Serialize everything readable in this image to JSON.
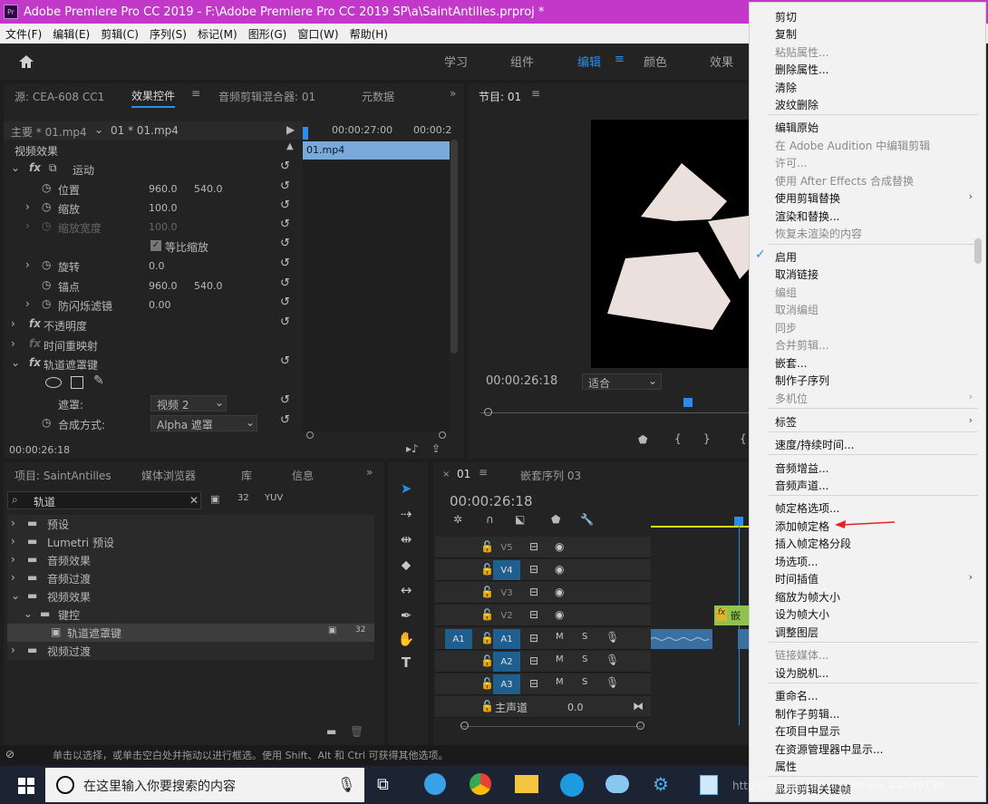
{
  "titlebar": {
    "app_icon": "Pr",
    "title": "Adobe Premiere Pro CC 2019 - F:\\Adobe Premiere Pro CC 2019 SP\\a\\SaintAntilles.prproj *"
  },
  "menubar": [
    "文件(F)",
    "编辑(E)",
    "剪辑(C)",
    "序列(S)",
    "标记(M)",
    "图形(G)",
    "窗口(W)",
    "帮助(H)"
  ],
  "workspaces": {
    "items": [
      "学习",
      "组件",
      "编辑",
      "颜色",
      "效果"
    ],
    "active": "编辑"
  },
  "effects_panel": {
    "tabs": [
      "源: CEA-608 CC1",
      "效果控件",
      "音频剪辑混合器: 01",
      "元数据"
    ],
    "active_tab": "效果控件",
    "clip_master": "主要 * 01.mp4",
    "clip_current": "01 * 01.mp4",
    "time_a": "00:00:27:00",
    "time_b": "00:00:2",
    "clip_bar": "01.mp4",
    "section": "视频效果",
    "motion": "运动",
    "position_label": "位置",
    "position_x": "960.0",
    "position_y": "540.0",
    "scale_label": "缩放",
    "scale_value": "100.0",
    "scale_width_label": "缩放宽度",
    "scale_width_value": "100.0",
    "uniform_scale_label": "等比缩放",
    "rotation_label": "旋转",
    "rotation_value": "0.0",
    "anchor_label": "锚点",
    "anchor_x": "960.0",
    "anchor_y": "540.0",
    "flicker_label": "防闪烁滤镜",
    "flicker_value": "0.00",
    "opacity_label": "不透明度",
    "time_remap_label": "时间重映射",
    "track_matte_label": "轨道遮罩键",
    "matte_label": "遮罩:",
    "matte_value": "视频 2",
    "composite_label": "合成方式:",
    "composite_value": "Alpha 遮罩",
    "timecode": "00:00:26:18"
  },
  "program_monitor": {
    "title": "节目: 01",
    "timecode": "00:00:26:18",
    "fit": "适合"
  },
  "project_panel": {
    "tabs": [
      "项目: SaintAntilles",
      "媒体浏览器",
      "库",
      "信息"
    ],
    "search": "轨道",
    "rows": [
      {
        "label": "预设",
        "indent": 0
      },
      {
        "label": "Lumetri 预设",
        "indent": 0
      },
      {
        "label": "音频效果",
        "indent": 0
      },
      {
        "label": "音频过渡",
        "indent": 0
      },
      {
        "label": "视频效果",
        "indent": 0
      },
      {
        "label": "键控",
        "indent": 1
      },
      {
        "label": "轨道遮罩键",
        "indent": 2
      },
      {
        "label": "视频过渡",
        "indent": 0
      }
    ]
  },
  "timeline": {
    "tab_active": "01",
    "tab_nested": "嵌套序列 03",
    "timecode": "00:00:26:18",
    "video_tracks": [
      "V5",
      "V4",
      "V3",
      "V2"
    ],
    "audio_tracks": [
      "A1",
      "A2",
      "A3"
    ],
    "source_patch": "A1",
    "master_label": "主声道",
    "master_value": "0.0",
    "mute": "M",
    "solo": "S",
    "fx": "fx",
    "clip_v2_label": "嵌"
  },
  "status_bar": "单击以选择，或单击空白处并拖动以进行框选。使用 Shift、Alt 和 Ctrl 可获得其他选项。",
  "context_menu": {
    "items": [
      {
        "label": "剪切",
        "enabled": true
      },
      {
        "label": "复制",
        "enabled": true
      },
      {
        "label": "粘贴属性...",
        "enabled": false
      },
      {
        "label": "删除属性...",
        "enabled": true
      },
      {
        "label": "清除",
        "enabled": true
      },
      {
        "label": "波纹删除",
        "enabled": true
      },
      {
        "label": "编辑原始",
        "enabled": true
      },
      {
        "label": "在 Adobe Audition 中编辑剪辑",
        "enabled": false
      },
      {
        "label": "许可...",
        "enabled": false
      },
      {
        "label": "使用 After Effects 合成替换",
        "enabled": false
      },
      {
        "label": "使用剪辑替换",
        "enabled": true
      },
      {
        "label": "渲染和替换...",
        "enabled": true
      },
      {
        "label": "恢复未渲染的内容",
        "enabled": false
      },
      {
        "label": "启用",
        "enabled": true
      },
      {
        "label": "取消链接",
        "enabled": true
      },
      {
        "label": "编组",
        "enabled": false
      },
      {
        "label": "取消编组",
        "enabled": false
      },
      {
        "label": "同步",
        "enabled": false
      },
      {
        "label": "合并剪辑...",
        "enabled": false
      },
      {
        "label": "嵌套...",
        "enabled": true
      },
      {
        "label": "制作子序列",
        "enabled": true
      },
      {
        "label": "多机位",
        "enabled": false
      },
      {
        "label": "标签",
        "enabled": true
      },
      {
        "label": "速度/持续时间...",
        "enabled": true
      },
      {
        "label": "音频增益...",
        "enabled": true
      },
      {
        "label": "音频声道...",
        "enabled": true
      },
      {
        "label": "帧定格选项...",
        "enabled": true
      },
      {
        "label": "添加帧定格",
        "enabled": true
      },
      {
        "label": "插入帧定格分段",
        "enabled": true
      },
      {
        "label": "场选项...",
        "enabled": true
      },
      {
        "label": "时间插值",
        "enabled": true
      },
      {
        "label": "缩放为帧大小",
        "enabled": true
      },
      {
        "label": "设为帧大小",
        "enabled": true
      },
      {
        "label": "调整图层",
        "enabled": true
      },
      {
        "label": "链接媒体...",
        "enabled": false
      },
      {
        "label": "设为脱机...",
        "enabled": true
      },
      {
        "label": "重命名...",
        "enabled": true
      },
      {
        "label": "制作子剪辑...",
        "enabled": true
      },
      {
        "label": "在项目中显示",
        "enabled": true
      },
      {
        "label": "在资源管理器中显示...",
        "enabled": true
      },
      {
        "label": "属性",
        "enabled": true
      },
      {
        "label": "显示剪辑关键帧",
        "enabled": true
      }
    ]
  },
  "taskbar": {
    "search_placeholder": "在这里输入你要搜索的内容",
    "watermark": "https://blog.csdn.net/weixin_44949135"
  },
  "colors": {
    "accent": "#2d8ceb",
    "titlebar": "#c239c9",
    "arrow": "#e0232b"
  }
}
